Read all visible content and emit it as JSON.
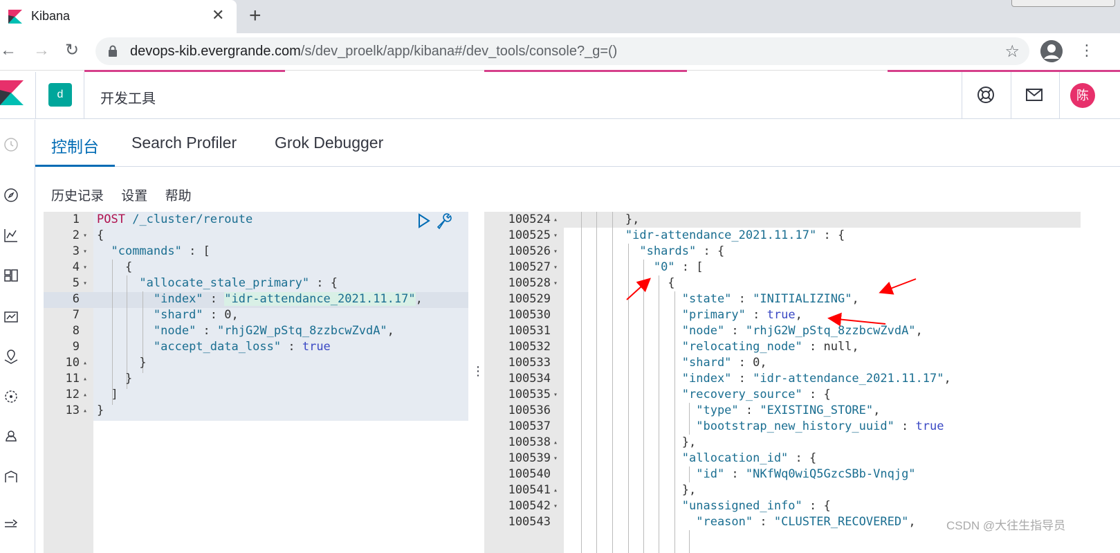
{
  "browser": {
    "tab_title": "Kibana",
    "url_host": "devops-kib.evergrande.com",
    "url_path": "/s/dev_proelk/app/kibana#/dev_tools/console?_g=()"
  },
  "header": {
    "space_initial": "d",
    "breadcrumb": "开发工具",
    "user_initial": "陈"
  },
  "tabs": [
    "控制台",
    "Search Profiler",
    "Grok Debugger"
  ],
  "submenu": [
    "历史记录",
    "设置",
    "帮助"
  ],
  "request": {
    "lines": [
      {
        "n": "1",
        "fold": "",
        "html": "<span class='meth'>POST</span> <span class='path'>/_cluster/reroute</span>"
      },
      {
        "n": "2",
        "fold": "▾",
        "html": "{"
      },
      {
        "n": "3",
        "fold": "▾",
        "html": "  <span class='key'>\"commands\"</span> : ["
      },
      {
        "n": "4",
        "fold": "▾",
        "html": "    {"
      },
      {
        "n": "5",
        "fold": "▾",
        "html": "      <span class='key'>\"allocate_stale_primary\"</span> : {"
      },
      {
        "n": "6",
        "fold": "",
        "html": "        <span class='key'>\"index\"</span> : <span class='str sel'>\"idr-attendance_2021.11.17\"</span>,"
      },
      {
        "n": "7",
        "fold": "",
        "html": "        <span class='key'>\"shard\"</span> : 0,"
      },
      {
        "n": "8",
        "fold": "",
        "html": "        <span class='key'>\"node\"</span> : <span class='str'>\"rhjG2W_pStq_8zzbcwZvdA\"</span>,"
      },
      {
        "n": "9",
        "fold": "",
        "html": "        <span class='key'>\"accept_data_loss\"</span> : <span class='bool'>true</span>"
      },
      {
        "n": "10",
        "fold": "▴",
        "html": "      }"
      },
      {
        "n": "11",
        "fold": "▴",
        "html": "    }"
      },
      {
        "n": "12",
        "fold": "▴",
        "html": "  ]"
      },
      {
        "n": "13",
        "fold": "▴",
        "html": "}"
      }
    ]
  },
  "response": {
    "lines": [
      {
        "n": "100524",
        "fold": "▴",
        "html": "        },"
      },
      {
        "n": "100525",
        "fold": "▾",
        "html": "        <span class='key'>\"idr-attendance_2021.11.17\"</span> : {"
      },
      {
        "n": "100526",
        "fold": "▾",
        "html": "          <span class='key'>\"shards\"</span> : {"
      },
      {
        "n": "100527",
        "fold": "▾",
        "html": "            <span class='key'>\"0\"</span> : ["
      },
      {
        "n": "100528",
        "fold": "▾",
        "html": "              {"
      },
      {
        "n": "100529",
        "fold": "",
        "html": "                <span class='key'>\"state\"</span> : <span class='str'>\"INITIALIZING\"</span>,"
      },
      {
        "n": "100530",
        "fold": "",
        "html": "                <span class='key'>\"primary\"</span> : <span class='bool'>true</span>,"
      },
      {
        "n": "100531",
        "fold": "",
        "html": "                <span class='key'>\"node\"</span> : <span class='str'>\"rhjG2W_pStq_8zzbcwZvdA\"</span>,"
      },
      {
        "n": "100532",
        "fold": "",
        "html": "                <span class='key'>\"relocating_node\"</span> : null,"
      },
      {
        "n": "100533",
        "fold": "",
        "html": "                <span class='key'>\"shard\"</span> : 0,"
      },
      {
        "n": "100534",
        "fold": "",
        "html": "                <span class='key'>\"index\"</span> : <span class='str'>\"idr-attendance_2021.11.17\"</span>,"
      },
      {
        "n": "100535",
        "fold": "▾",
        "html": "                <span class='key'>\"recovery_source\"</span> : {"
      },
      {
        "n": "100536",
        "fold": "",
        "html": "                  <span class='key'>\"type\"</span> : <span class='str'>\"EXISTING_STORE\"</span>,"
      },
      {
        "n": "100537",
        "fold": "",
        "html": "                  <span class='key'>\"bootstrap_new_history_uuid\"</span> : <span class='bool'>true</span>"
      },
      {
        "n": "100538",
        "fold": "▴",
        "html": "                },"
      },
      {
        "n": "100539",
        "fold": "▾",
        "html": "                <span class='key'>\"allocation_id\"</span> : {"
      },
      {
        "n": "100540",
        "fold": "",
        "html": "                  <span class='key'>\"id\"</span> : <span class='str'>\"NKfWq0wiQ5GzcSBb-Vnqjg\"</span>"
      },
      {
        "n": "100541",
        "fold": "▴",
        "html": "                },"
      },
      {
        "n": "100542",
        "fold": "▾",
        "html": "                <span class='key'>\"unassigned_info\"</span> : {"
      },
      {
        "n": "100543",
        "fold": "",
        "html": "                  <span class='key'>\"reason\"</span> : <span class='str'>\"CLUSTER_RECOVERED\"</span>,"
      }
    ]
  },
  "watermark": "CSDN @大往生指导员",
  "colors": {
    "accent": "#006bb4",
    "brand": "#e7306b",
    "space": "#00a69b",
    "arrow": "#ff0000"
  }
}
